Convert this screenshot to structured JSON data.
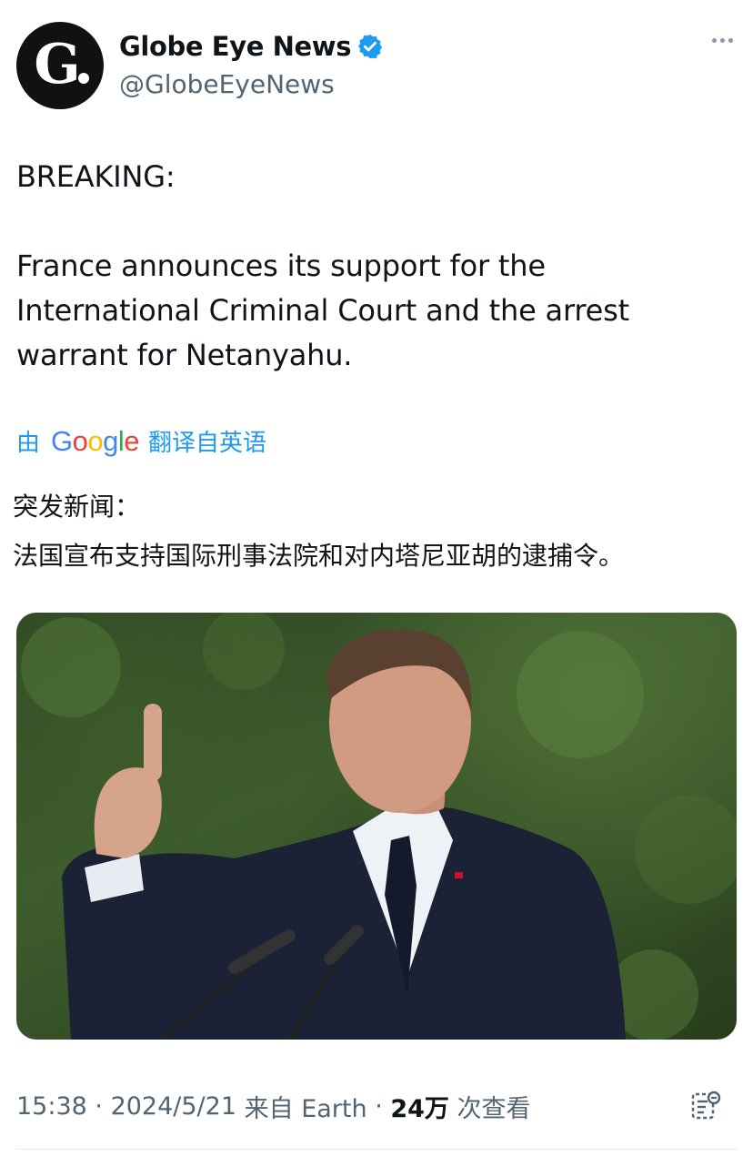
{
  "account": {
    "display_name": "Globe Eye News",
    "handle": "@GlobeEyeNews",
    "avatar_letter": "G",
    "verified_color": "#1d9bf0"
  },
  "tweet": {
    "text": "BREAKING:\n\nFrance announces its support for the\nInternational Criminal Court and the arrest\nwarrant for Netanyahu.",
    "translate_prefix": "由",
    "translate_brand": "Google",
    "translate_suffix": "翻译自英语",
    "translated_text": "突发新闻：\n法国宣布支持国际刑事法院和对内塔尼亚胡的逮捕令。",
    "image_alt": "Man in a dark suit speaking at microphones, raising his index finger, in front of green foliage"
  },
  "meta": {
    "time": "15:38",
    "date": "2024/5/21",
    "source": "来自 Earth",
    "views_count": "24万",
    "views_label": "次查看"
  },
  "colors": {
    "link": "#1d9bf0",
    "secondary_text": "#536471"
  }
}
